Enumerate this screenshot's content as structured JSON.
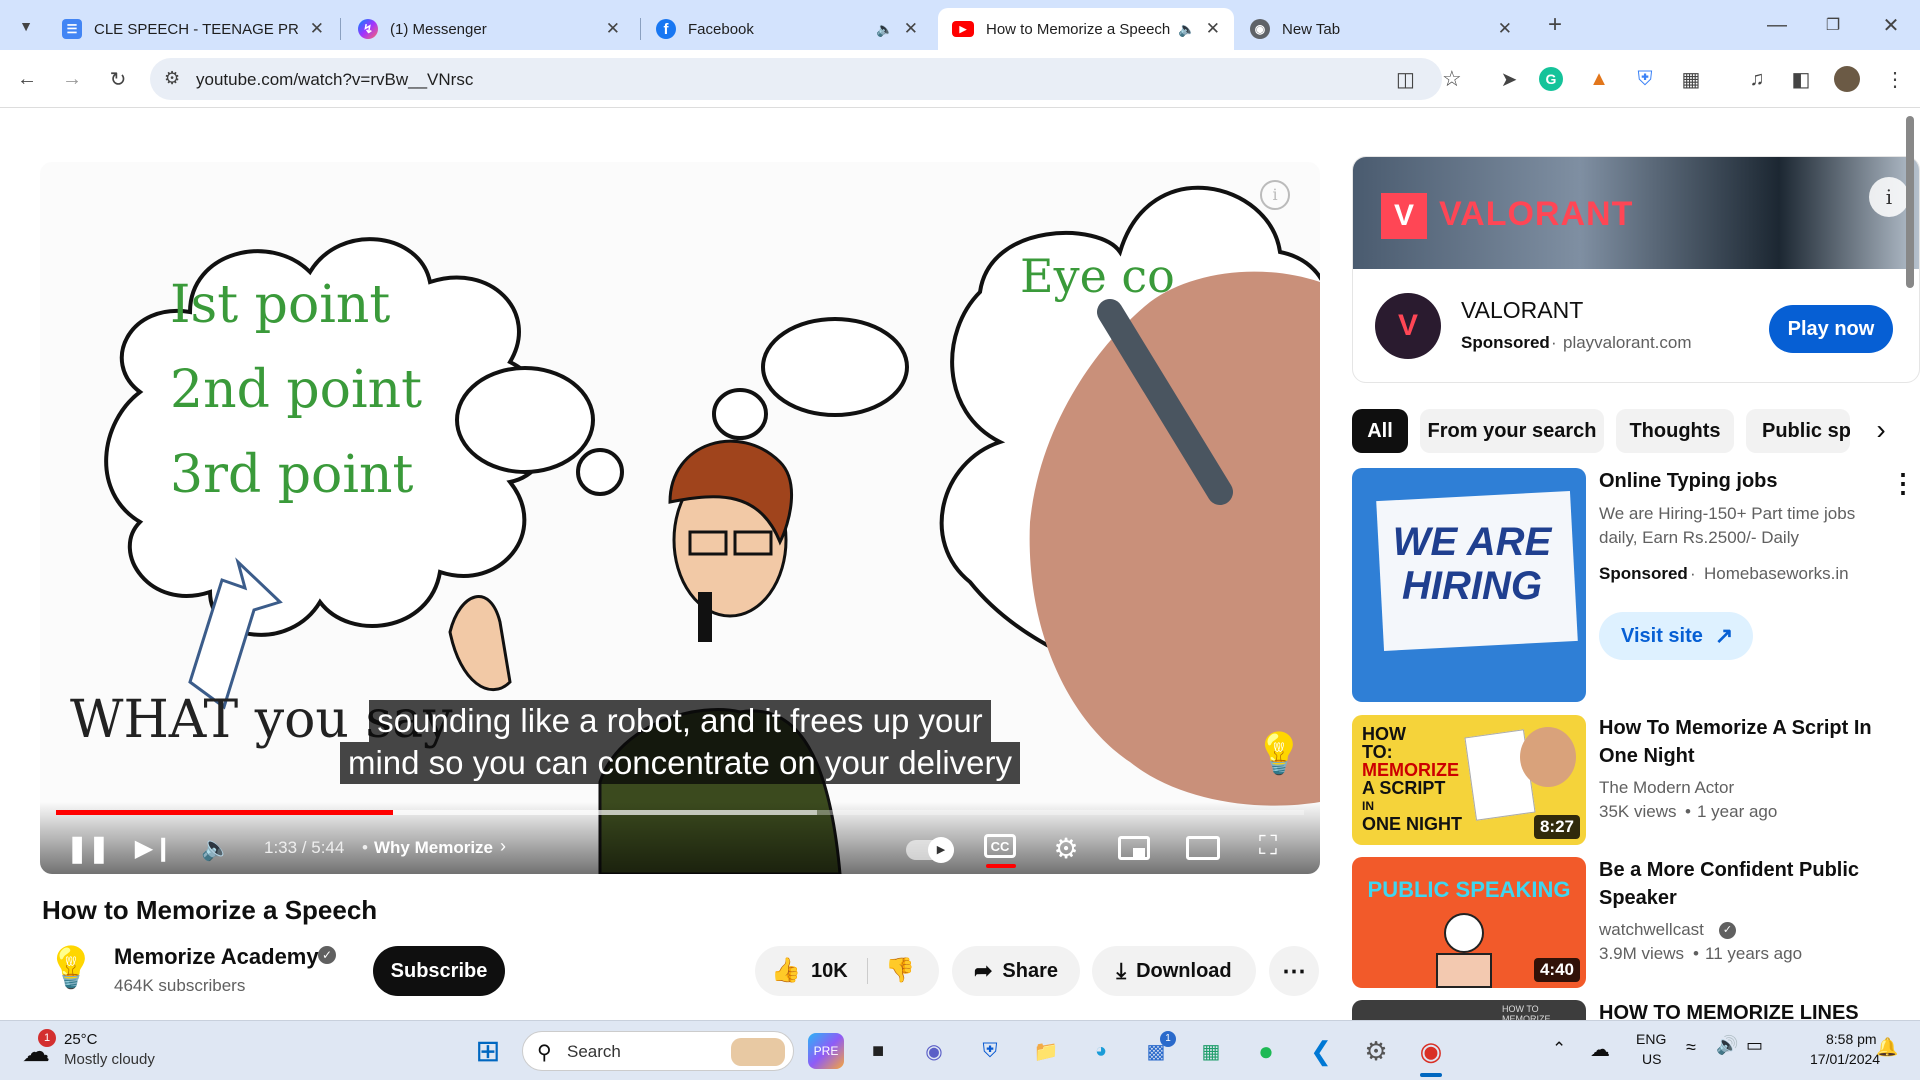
{
  "browser": {
    "tabs": [
      {
        "title": "CLE SPEECH - TEENAGE PREGN",
        "icon": "docs-icon"
      },
      {
        "title": "(1) Messenger",
        "icon": "messenger-icon"
      },
      {
        "title": "Facebook",
        "icon": "facebook-icon"
      },
      {
        "title": "How to Memorize a Speech",
        "icon": "youtube-icon"
      },
      {
        "title": "New Tab",
        "icon": "chrome-icon"
      }
    ],
    "active_tab_index": 3,
    "url": "youtube.com/watch?v=rvBw__VNrsc"
  },
  "video": {
    "drawing_text": {
      "cloud_lines": [
        "Ist point",
        "2nd point",
        "3rd point"
      ],
      "eye_text": "Eye co",
      "what_text": "WHAT you say"
    },
    "caption_lines": [
      "sounding like a robot, and it frees up your",
      "mind so you can concentrate on your delivery"
    ],
    "time": "1:33 / 5:44",
    "chapter": "Why Memorize",
    "progress_fraction": 0.27,
    "buffered_fraction": 0.61,
    "title": "How to Memorize a Speech"
  },
  "channel": {
    "name": "Memorize Academy",
    "subscribers": "464K subscribers",
    "subscribe_label": "Subscribe"
  },
  "actions": {
    "likes": "10K",
    "share": "Share",
    "download": "Download"
  },
  "ad": {
    "brand_banner": "VALORANT",
    "name": "VALORANT",
    "sponsored": "Sponsored",
    "domain": "playvalorant.com",
    "cta": "Play now"
  },
  "chips": [
    "All",
    "From your search",
    "Thoughts",
    "Public sp"
  ],
  "sidebar": {
    "promo": {
      "thumb_text": [
        "WE ARE",
        "HIRING"
      ],
      "title": "Online Typing jobs",
      "desc_line1": "We are Hiring-150+ Part time jobs",
      "desc_line2": "daily, Earn Rs.2500/- Daily",
      "sponsored": "Sponsored",
      "domain": "Homebaseworks.in",
      "cta": "Visit site"
    },
    "videos": [
      {
        "title_line1": "How To Memorize A Script In",
        "title_line2": "One Night",
        "channel": "The Modern Actor",
        "views": "35K views",
        "age": "1 year ago",
        "duration": "8:27",
        "thumb_text": [
          "HOW",
          "TO:",
          "MEMORIZE",
          "A SCRIPT",
          "IN",
          "ONE NIGHT"
        ]
      },
      {
        "title_line1": "Be a More Confident Public",
        "title_line2": "Speaker",
        "channel": "watchwellcast",
        "views": "3.9M views",
        "age": "11 years ago",
        "duration": "4:40",
        "thumb_text": [
          "PUBLIC SPEAKING"
        ]
      },
      {
        "title_line1": "HOW TO MEMORIZE LINES",
        "thumb_text": [
          "HOW TO MEMORIZE"
        ]
      }
    ]
  },
  "taskbar": {
    "weather_temp": "25°C",
    "weather_desc": "Mostly cloudy",
    "weather_badge": "1",
    "search_label": "Search",
    "teams_badge": "1",
    "lang_line1": "ENG",
    "lang_line2": "US",
    "time": "8:58 pm",
    "date": "17/01/2024"
  },
  "colors": {
    "tabstrip_bg": "#d3e3fd",
    "youtube_red": "#ff0000",
    "play_now_blue": "#065fd4",
    "valorant_red": "#ff4655",
    "drawing_green": "#3a9a3a"
  }
}
